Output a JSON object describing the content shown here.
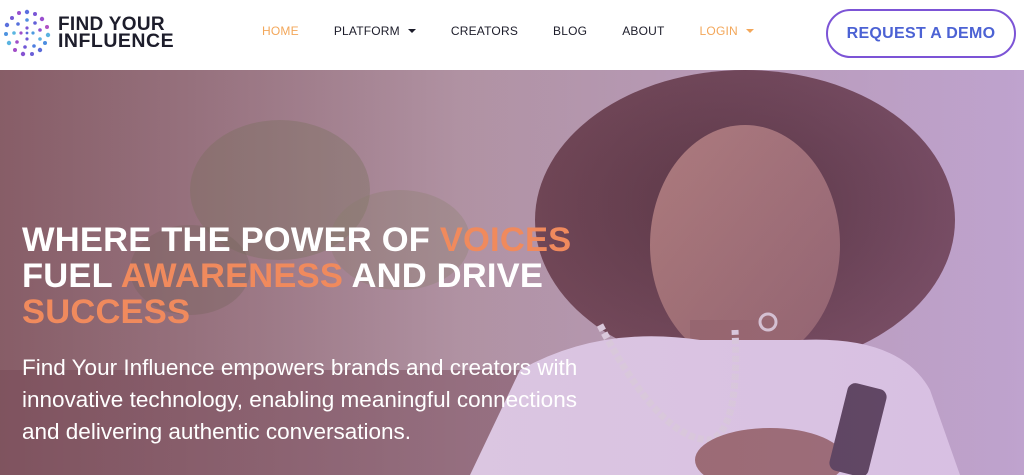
{
  "brand": {
    "line1": "FIND YOUR",
    "line2": "INFLUENCE",
    "logo_icon": "dotted-circle-logo-icon"
  },
  "nav": {
    "items": [
      {
        "label": "HOME",
        "active": true,
        "dropdown": false
      },
      {
        "label": "PLATFORM",
        "active": false,
        "dropdown": true
      },
      {
        "label": "CREATORS",
        "active": false,
        "dropdown": false
      },
      {
        "label": "BLOG",
        "active": false,
        "dropdown": false
      },
      {
        "label": "ABOUT",
        "active": false,
        "dropdown": false
      },
      {
        "label": "LOGIN",
        "active": true,
        "dropdown": true
      }
    ]
  },
  "cta": {
    "request_demo": "REQUEST A DEMO"
  },
  "hero": {
    "headline": {
      "p1": "WHERE THE POWER OF ",
      "a1": "VOICES",
      "p2": "FUEL ",
      "a2": "AWARENESS",
      "p3": " AND DRIVE",
      "a3": "SUCCESS"
    },
    "subtext": "Find Your Influence empowers brands and creators with innovative technology, enabling meaningful connections and delivering authentic conversations."
  },
  "colors": {
    "accent_orange": "#f08a5d",
    "nav_active": "#f3a75a",
    "cta_text": "#4c62d4",
    "cta_border": "#7c54d6",
    "hero_overlay": "#a98bb1"
  }
}
